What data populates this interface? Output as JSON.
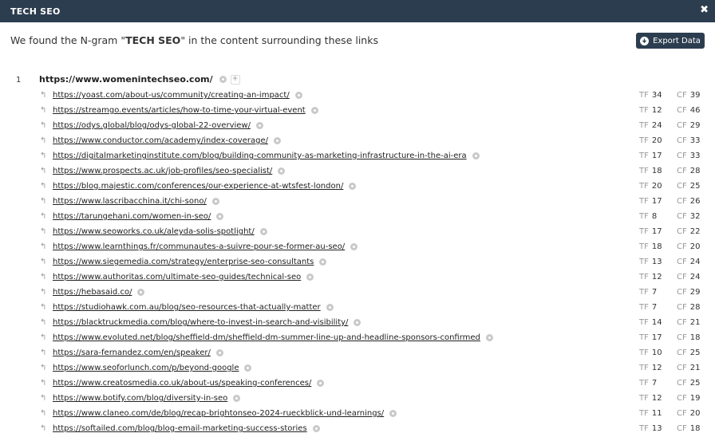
{
  "title": "TECH SEO",
  "heading": {
    "prefix": "We found the N-gram \"",
    "term": "TECH SEO",
    "suffix": "\" in the content surrounding these links"
  },
  "export_label": "Export Data",
  "row_number": "1",
  "site_url": "https://www.womenintechseo.com/",
  "tf_label": "TF",
  "cf_label": "CF",
  "links": [
    {
      "url": "https://yoast.com/about-us/community/creating-an-impact/",
      "tf": "34",
      "cf": "39"
    },
    {
      "url": "https://streamgo.events/articles/how-to-time-your-virtual-event",
      "tf": "12",
      "cf": "46"
    },
    {
      "url": "https://odys.global/blog/odys-global-22-overview/",
      "tf": "24",
      "cf": "29"
    },
    {
      "url": "https://www.conductor.com/academy/index-coverage/",
      "tf": "20",
      "cf": "33"
    },
    {
      "url": "https://digitalmarketinginstitute.com/blog/building-community-as-marketing-infrastructure-in-the-ai-era",
      "tf": "17",
      "cf": "33"
    },
    {
      "url": "https://www.prospects.ac.uk/job-profiles/seo-specialist/",
      "tf": "18",
      "cf": "28"
    },
    {
      "url": "https://blog.majestic.com/conferences/our-experience-at-wtsfest-london/",
      "tf": "20",
      "cf": "25"
    },
    {
      "url": "https://www.lascribacchina.it/chi-sono/",
      "tf": "17",
      "cf": "26"
    },
    {
      "url": "https://tarungehani.com/women-in-seo/",
      "tf": "8",
      "cf": "32"
    },
    {
      "url": "https://www.seoworks.co.uk/aleyda-solis-spotlight/",
      "tf": "17",
      "cf": "22"
    },
    {
      "url": "https://www.learnthings.fr/communautes-a-suivre-pour-se-former-au-seo/",
      "tf": "18",
      "cf": "20"
    },
    {
      "url": "https://www.siegemedia.com/strategy/enterprise-seo-consultants",
      "tf": "13",
      "cf": "24"
    },
    {
      "url": "https://www.authoritas.com/ultimate-seo-guides/technical-seo",
      "tf": "12",
      "cf": "24"
    },
    {
      "url": "https://hebasaid.co/",
      "tf": "7",
      "cf": "29"
    },
    {
      "url": "https://studiohawk.com.au/blog/seo-resources-that-actually-matter",
      "tf": "7",
      "cf": "28"
    },
    {
      "url": "https://blacktruckmedia.com/blog/where-to-invest-in-search-and-visibility/",
      "tf": "14",
      "cf": "21"
    },
    {
      "url": "https://www.evoluted.net/blog/sheffield-dm/sheffield-dm-summer-line-up-and-headline-sponsors-confirmed",
      "tf": "17",
      "cf": "18"
    },
    {
      "url": "https://sara-fernandez.com/en/speaker/",
      "tf": "10",
      "cf": "25"
    },
    {
      "url": "https://www.seoforlunch.com/p/beyond-google",
      "tf": "12",
      "cf": "21"
    },
    {
      "url": "https://www.creatosmedia.co.uk/about-us/speaking-conferences/",
      "tf": "7",
      "cf": "25"
    },
    {
      "url": "https://www.botify.com/blog/diversity-in-seo",
      "tf": "12",
      "cf": "19"
    },
    {
      "url": "https://www.claneo.com/de/blog/recap-brightonseo-2024-rueckblick-und-learnings/",
      "tf": "11",
      "cf": "20"
    },
    {
      "url": "https://softailed.com/blog/blog-email-marketing-success-stories",
      "tf": "13",
      "cf": "18"
    }
  ]
}
